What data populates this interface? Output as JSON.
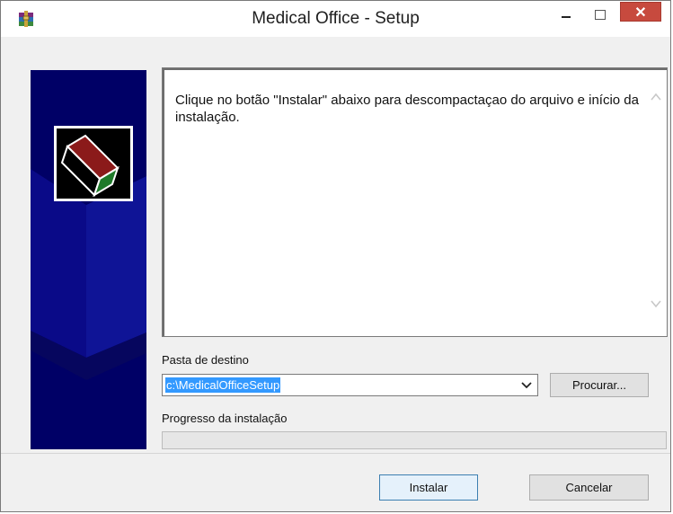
{
  "window": {
    "title": "Medical Office - Setup",
    "app_icon": "winrar-archive-icon",
    "controls": {
      "minimize": "minimize-icon",
      "maximize": "maximize-icon",
      "close": "✕"
    }
  },
  "message": {
    "text": "Clique no botão  \"Instalar\" abaixo para descompactaçao do arquivo e início da instalação."
  },
  "destination": {
    "label": "Pasta de destino",
    "value": "c:\\MedicalOfficeSetup",
    "browse_label": "Procurar..."
  },
  "progress": {
    "label": "Progresso da instalação",
    "value": 0
  },
  "buttons": {
    "install": "Instalar",
    "cancel": "Cancelar"
  },
  "colors": {
    "banner": "#000066",
    "close_button": "#c74a3e",
    "selection": "#3399ff"
  }
}
